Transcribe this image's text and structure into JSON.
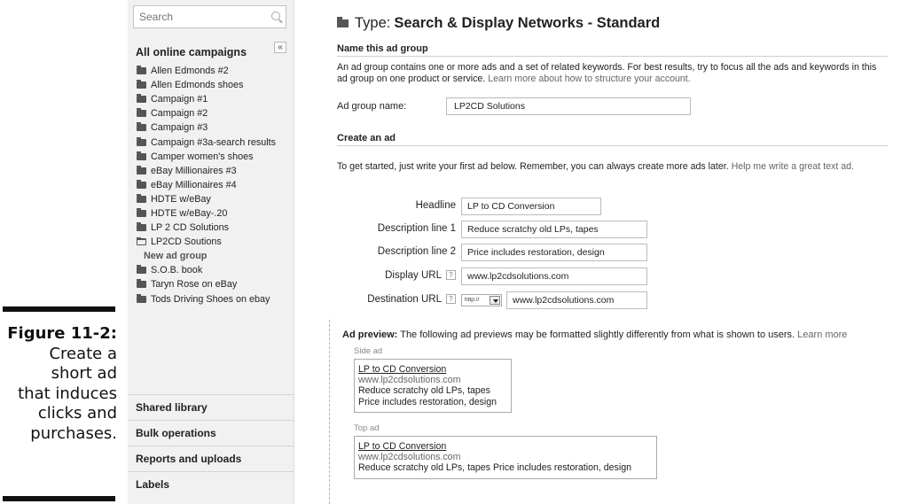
{
  "figure": {
    "number": "Figure 11-2:",
    "caption_lines": [
      "Create a",
      "short ad",
      "that induces",
      "clicks and",
      "purchases."
    ]
  },
  "sidebar": {
    "search_placeholder": "Search",
    "all_campaigns": "All online campaigns",
    "collapse_label": "«",
    "campaigns": [
      "Allen Edmonds #2",
      "Allen Edmonds shoes",
      "Campaign #1",
      "Campaign #2",
      "Campaign #3",
      "Campaign #3a-search results",
      "Camper women's shoes",
      "eBay Millionaires #3",
      "eBay Millionaires #4",
      "HDTE w/eBay",
      "HDTE w/eBay-.20",
      "LP 2 CD Solutions",
      "LP2CD Soutions",
      "New ad group",
      "S.O.B. book",
      "Taryn Rose on eBay",
      "Tods Driving Shoes on ebay"
    ],
    "sections": [
      "Shared library",
      "Bulk operations",
      "Reports and uploads",
      "Labels"
    ]
  },
  "main": {
    "type_label": "Type:",
    "type_value": "Search & Display Networks - Standard",
    "name_section": "Name this ad group",
    "name_para": "An ad group contains one or more ads and a set of related keywords. For best results, try to focus all the ads and keywords in this ad group on one product or service.",
    "name_link": "Learn more about how to structure your account.",
    "ad_group_name_label": "Ad group name:",
    "ad_group_name_value": "LP2CD Solutions",
    "create_section": "Create an ad",
    "create_para": "To get started, just write your first ad below. Remember, you can always create more ads later.",
    "create_link": "Help me write a great text ad.",
    "form": {
      "headline_label": "Headline",
      "headline_value": "LP to CD Conversion",
      "desc1_label": "Description line 1",
      "desc1_value": "Reduce scratchy old LPs, tapes",
      "desc2_label": "Description line 2",
      "desc2_value": "Price includes restoration, design",
      "display_url_label": "Display URL",
      "display_url_value": "www.lp2cdsolutions.com",
      "dest_url_label": "Destination URL",
      "dest_protocol": "http://",
      "dest_url_value": "www.lp2cdsolutions.com",
      "help_glyph": "?"
    },
    "preview": {
      "title": "Ad preview:",
      "text": "The following ad previews may be formatted slightly differently from what is shown to users.",
      "link": "Learn more",
      "side_label": "Side ad",
      "top_label": "Top ad",
      "ad_headline": "LP to CD Conversion",
      "ad_url": "www.lp2cdsolutions.com",
      "ad_desc1": "Reduce scratchy old LPs, tapes",
      "ad_desc2": "Price includes restoration, design"
    }
  }
}
